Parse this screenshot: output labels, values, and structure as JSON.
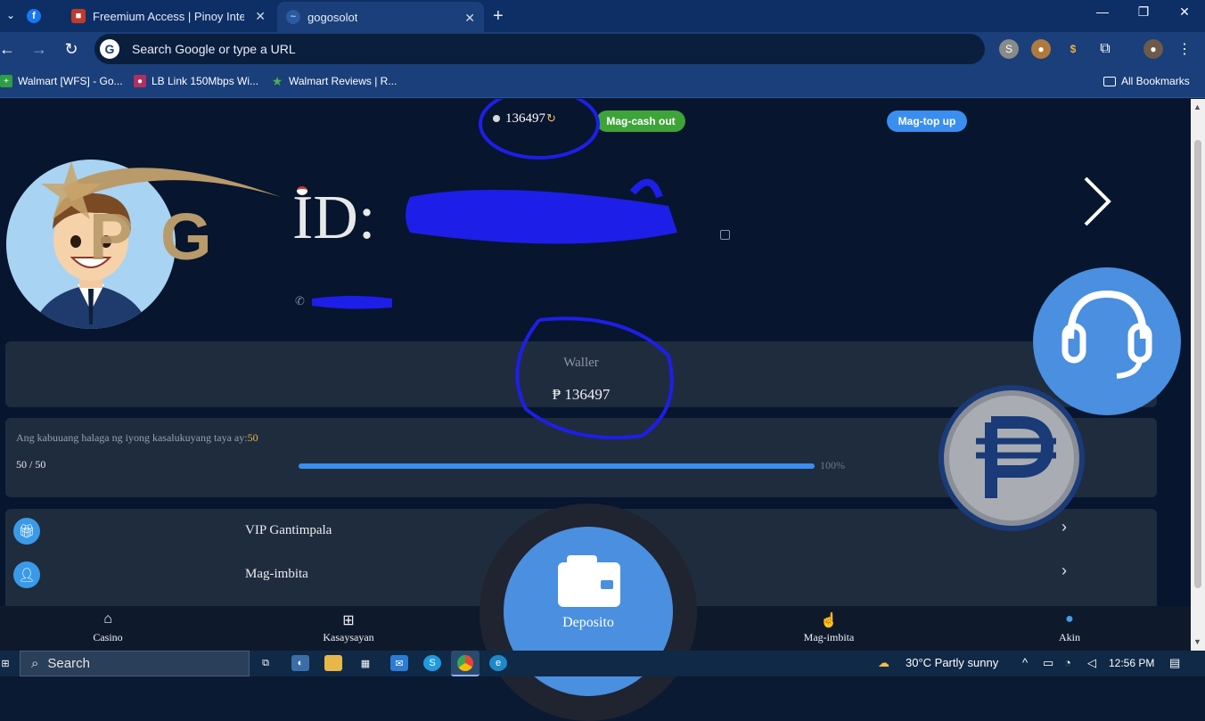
{
  "browser": {
    "tabs": [
      {
        "label": "",
        "icon": "facebook-icon"
      },
      {
        "label": "Freemium Access | Pinoy Intern",
        "icon": "box-icon"
      },
      {
        "label": "gogosolot",
        "icon": "site-icon",
        "active": true
      }
    ],
    "new_tab": "+",
    "address_placeholder": "Search Google or type a URL",
    "bookmarks": [
      {
        "label": "Walmart [WFS] - Go...",
        "icon": "plus-icon"
      },
      {
        "label": "LB Link 150Mbps Wi...",
        "icon": "lblink-icon"
      },
      {
        "label": "Walmart Reviews | R...",
        "icon": "star-icon"
      }
    ],
    "all_bookmarks": "All Bookmarks"
  },
  "header": {
    "coin_balance": "136497",
    "cashout_label": "Mag-cash out",
    "topup_label": "Mag-top up",
    "logo_text": "PG"
  },
  "profile": {
    "id_label": "ID:"
  },
  "wallet": {
    "label": "Waller",
    "amount": "₱ 136497"
  },
  "bet": {
    "text": "Ang kabuuang halaga ng iyong kasalukuyang taya ay:",
    "value": "50",
    "count": "50 / 50",
    "progress": 1.0,
    "percent": "100%"
  },
  "menu": [
    {
      "label": "VIP Gantimpala",
      "icon": "gift-icon"
    },
    {
      "label": "Mag-imbita",
      "icon": "add-user-icon"
    }
  ],
  "bottom_nav": {
    "casino": "Casino",
    "history": "Kasaysayan",
    "deposit": "Deposito",
    "invite": "Mag-imbita",
    "mine": "Akin"
  },
  "taskbar": {
    "search": "Search",
    "weather": "30°C  Partly sunny",
    "time": "12:56 PM"
  },
  "colors": {
    "accent_blue": "#4a8fe0",
    "green": "#3ea43a",
    "gold": "#e9b949",
    "page_bg": "#07152e"
  }
}
